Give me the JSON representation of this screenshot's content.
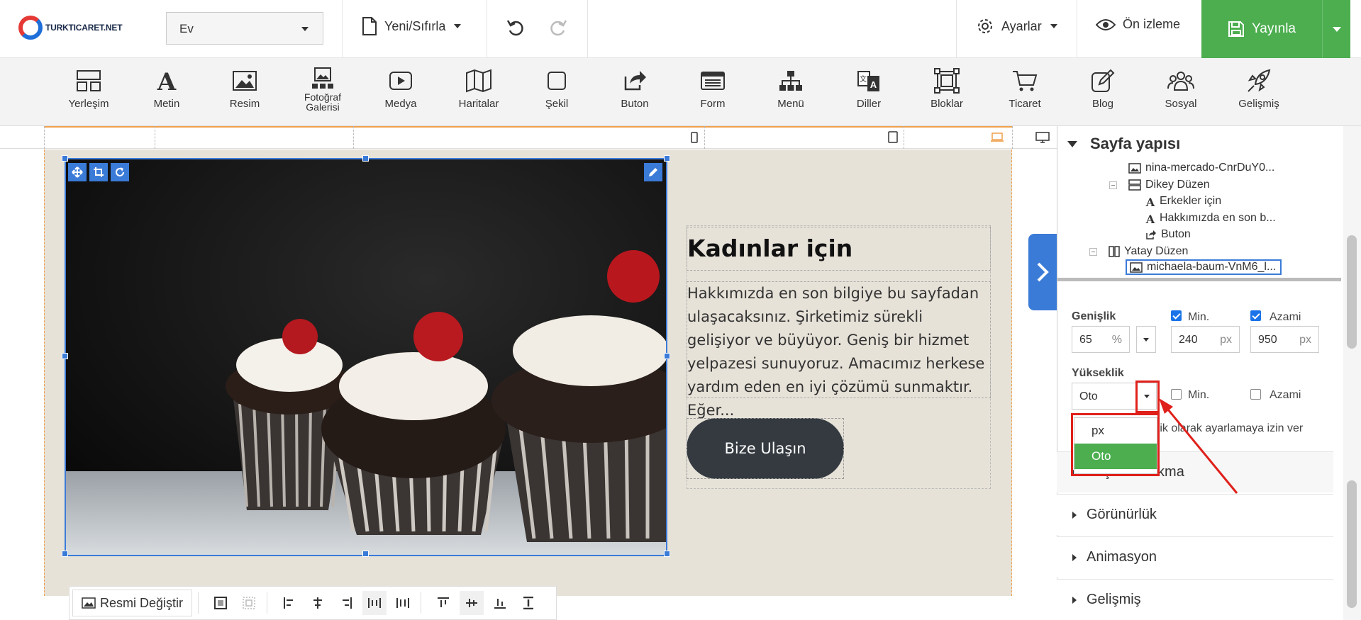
{
  "header": {
    "logo_text": "TURKTICARET.NET",
    "page_select": "Ev",
    "new_reset": "Yeni/Sıfırla",
    "settings": "Ayarlar",
    "preview": "Ön izleme",
    "publish": "Yayınla"
  },
  "toolbar": {
    "items": [
      {
        "label": "Yerleşim",
        "icon": "layout-icon"
      },
      {
        "label": "Metin",
        "icon": "text-icon"
      },
      {
        "label": "Resim",
        "icon": "image-icon"
      },
      {
        "label": "Fotoğraf Galerisi",
        "icon": "gallery-icon"
      },
      {
        "label": "Medya",
        "icon": "media-icon"
      },
      {
        "label": "Haritalar",
        "icon": "map-icon"
      },
      {
        "label": "Şekil",
        "icon": "shape-icon"
      },
      {
        "label": "Buton",
        "icon": "button-icon"
      },
      {
        "label": "Form",
        "icon": "form-icon"
      },
      {
        "label": "Menü",
        "icon": "menu-icon"
      },
      {
        "label": "Diller",
        "icon": "languages-icon"
      },
      {
        "label": "Bloklar",
        "icon": "blocks-icon"
      },
      {
        "label": "Ticaret",
        "icon": "cart-icon"
      },
      {
        "label": "Blog",
        "icon": "blog-icon"
      },
      {
        "label": "Sosyal",
        "icon": "social-icon"
      },
      {
        "label": "Gelişmiş",
        "icon": "rocket-icon"
      }
    ],
    "gallery_line1": "Fotoğraf",
    "gallery_line2": "Galerisi"
  },
  "content": {
    "heading": "Kadınlar için",
    "paragraph": "Hakkımızda en son bilgiye bu sayfadan ulaşacaksınız. Şirketimiz sürekli gelişiyor ve büyüyor. Geniş bir hizmet yelpazesi sunuyoruz. Amacımız herkese yardım eden en iyi çözümü sunmaktır. Eğer...",
    "cta": "Bize Ulaşın"
  },
  "image_toolbar": {
    "change_image": "Resmi Değiştir"
  },
  "panel": {
    "title": "Sayfa yapısı",
    "tree": [
      {
        "label": "nina-mercado-CnrDuY0..."
      },
      {
        "label": "Dikey Düzen"
      },
      {
        "label": "Erkekler için"
      },
      {
        "label": "Hakkımızda en son b..."
      },
      {
        "label": "Buton"
      },
      {
        "label": "Yatay Düzen"
      },
      {
        "label": "michaela-baum-VnM6_l..."
      }
    ],
    "width_label": "Genişlik",
    "width_value": "65",
    "width_unit": "%",
    "min_label": "Min.",
    "min_value": "240",
    "max_label": "Azami",
    "max_value": "950",
    "px": "px",
    "height_label": "Yükseklik",
    "height_value": "Oto",
    "height_min_label": "Min.",
    "height_max_label": "Azami",
    "auto_note": "atik olarak ayarlamaya izin ver",
    "dropdown_options": [
      "px",
      "Oto"
    ],
    "accordions": [
      "Boşluk bırakma",
      "Görünürlük",
      "Animasyon",
      "Gelişmiş"
    ]
  },
  "colors": {
    "publish_green": "#4cae4f",
    "selection_blue": "#3b7bd8",
    "annotation_red": "#e0201b",
    "section_bg": "#e7e2d8",
    "button_dark": "#343a40"
  }
}
